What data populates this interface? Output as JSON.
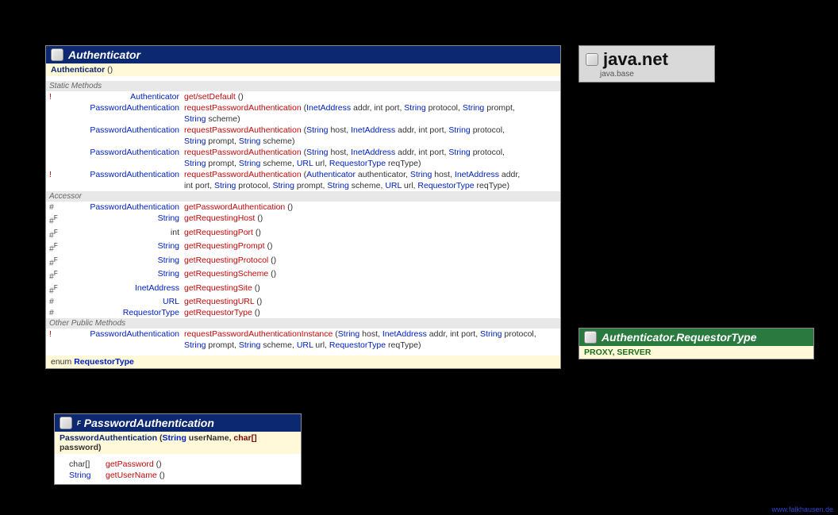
{
  "footer": "www.falkhausen.de",
  "pkg": {
    "name": "java.net",
    "module": "java.base"
  },
  "auth": {
    "title": "Authenticator",
    "constructor": "Authenticator",
    "sect_static": "Static Methods",
    "sect_accessor": "Accessor",
    "sect_other": "Other Public Methods",
    "enum_kw": "enum",
    "enum_name": "RequestorType",
    "static": [
      {
        "mod": "!",
        "ret": "Authenticator",
        "name": "get/setDefault",
        "sig": " ()"
      },
      {
        "mod": "",
        "ret": "PasswordAuthentication",
        "name": "requestPasswordAuthentication",
        "sig": " (",
        "parts": [
          {
            "t": "InetAddress",
            "k": "type"
          },
          {
            "t": " addr, ",
            "k": "dark"
          },
          {
            "t": "int",
            "k": "dark"
          },
          {
            "t": " port, ",
            "k": "dark"
          },
          {
            "t": "String",
            "k": "type"
          },
          {
            "t": " protocol, ",
            "k": "dark"
          },
          {
            "t": "String",
            "k": "type"
          },
          {
            "t": " prompt,",
            "k": "dark"
          }
        ],
        "cont": [
          {
            "t": "String",
            "k": "type"
          },
          {
            "t": " scheme)",
            "k": "dark"
          }
        ]
      },
      {
        "mod": "",
        "ret": "PasswordAuthentication",
        "name": "requestPasswordAuthentication",
        "sig": " (",
        "parts": [
          {
            "t": "String",
            "k": "type"
          },
          {
            "t": " host, ",
            "k": "dark"
          },
          {
            "t": "InetAddress",
            "k": "type"
          },
          {
            "t": " addr, ",
            "k": "dark"
          },
          {
            "t": "int",
            "k": "dark"
          },
          {
            "t": " port, ",
            "k": "dark"
          },
          {
            "t": "String",
            "k": "type"
          },
          {
            "t": " protocol,",
            "k": "dark"
          }
        ],
        "cont": [
          {
            "t": "String",
            "k": "type"
          },
          {
            "t": " prompt, ",
            "k": "dark"
          },
          {
            "t": "String",
            "k": "type"
          },
          {
            "t": " scheme)",
            "k": "dark"
          }
        ]
      },
      {
        "mod": "",
        "ret": "PasswordAuthentication",
        "name": "requestPasswordAuthentication",
        "sig": " (",
        "parts": [
          {
            "t": "String",
            "k": "type"
          },
          {
            "t": " host, ",
            "k": "dark"
          },
          {
            "t": "InetAddress",
            "k": "type"
          },
          {
            "t": " addr, ",
            "k": "dark"
          },
          {
            "t": "int",
            "k": "dark"
          },
          {
            "t": " port, ",
            "k": "dark"
          },
          {
            "t": "String",
            "k": "type"
          },
          {
            "t": " protocol,",
            "k": "dark"
          }
        ],
        "cont": [
          {
            "t": "String",
            "k": "type"
          },
          {
            "t": " prompt, ",
            "k": "dark"
          },
          {
            "t": "String",
            "k": "type"
          },
          {
            "t": " scheme, ",
            "k": "dark"
          },
          {
            "t": "URL",
            "k": "type"
          },
          {
            "t": " url, ",
            "k": "dark"
          },
          {
            "t": "RequestorType",
            "k": "type"
          },
          {
            "t": " reqType)",
            "k": "dark"
          }
        ]
      },
      {
        "mod": "!",
        "ret": "PasswordAuthentication",
        "name": "requestPasswordAuthentication",
        "sig": " (",
        "parts": [
          {
            "t": "Authenticator",
            "k": "type"
          },
          {
            "t": " authenticator, ",
            "k": "dark"
          },
          {
            "t": "String",
            "k": "type"
          },
          {
            "t": " host, ",
            "k": "dark"
          },
          {
            "t": "InetAddress",
            "k": "type"
          },
          {
            "t": " addr,",
            "k": "dark"
          }
        ],
        "cont": [
          {
            "t": "int",
            "k": "dark"
          },
          {
            "t": " port, ",
            "k": "dark"
          },
          {
            "t": "String",
            "k": "type"
          },
          {
            "t": " protocol, ",
            "k": "dark"
          },
          {
            "t": "String",
            "k": "type"
          },
          {
            "t": " prompt, ",
            "k": "dark"
          },
          {
            "t": "String",
            "k": "type"
          },
          {
            "t": " scheme, ",
            "k": "dark"
          },
          {
            "t": "URL",
            "k": "type"
          },
          {
            "t": " url, ",
            "k": "dark"
          },
          {
            "t": "RequestorType",
            "k": "type"
          },
          {
            "t": " reqType)",
            "k": "dark"
          }
        ]
      }
    ],
    "accessor": [
      {
        "mod": "#",
        "ret": "PasswordAuthentication",
        "name": "getPasswordAuthentication",
        "sig": " ()"
      },
      {
        "mod": "#",
        "sup": "F",
        "ret": "String",
        "name": "getRequestingHost",
        "sig": " ()"
      },
      {
        "mod": "#",
        "sup": "F",
        "ret": "int",
        "retdark": true,
        "name": "getRequestingPort",
        "sig": " ()"
      },
      {
        "mod": "#",
        "sup": "F",
        "ret": "String",
        "name": "getRequestingPrompt",
        "sig": " ()"
      },
      {
        "mod": "#",
        "sup": "F",
        "ret": "String",
        "name": "getRequestingProtocol",
        "sig": " ()"
      },
      {
        "mod": "#",
        "sup": "F",
        "ret": "String",
        "name": "getRequestingScheme",
        "sig": " ()"
      },
      {
        "mod": "#",
        "sup": "F",
        "ret": "InetAddress",
        "name": "getRequestingSite",
        "sig": " ()"
      },
      {
        "mod": "#",
        "ret": "URL",
        "name": "getRequestingURL",
        "sig": " ()"
      },
      {
        "mod": "#",
        "ret": "RequestorType",
        "name": "getRequestorType",
        "sig": " ()"
      }
    ],
    "other": [
      {
        "mod": "!",
        "ret": "PasswordAuthentication",
        "name": "requestPasswordAuthenticationInstance",
        "sig": " (",
        "parts": [
          {
            "t": "String",
            "k": "type"
          },
          {
            "t": " host, ",
            "k": "dark"
          },
          {
            "t": "InetAddress",
            "k": "type"
          },
          {
            "t": " addr, ",
            "k": "dark"
          },
          {
            "t": "int",
            "k": "dark"
          },
          {
            "t": " port, ",
            "k": "dark"
          },
          {
            "t": "String",
            "k": "type"
          },
          {
            "t": " protocol,",
            "k": "dark"
          }
        ],
        "cont": [
          {
            "t": "String",
            "k": "type"
          },
          {
            "t": " prompt, ",
            "k": "dark"
          },
          {
            "t": "String",
            "k": "type"
          },
          {
            "t": " scheme, ",
            "k": "dark"
          },
          {
            "t": "URL",
            "k": "type"
          },
          {
            "t": " url, ",
            "k": "dark"
          },
          {
            "t": "RequestorType",
            "k": "type"
          },
          {
            "t": " reqType)",
            "k": "dark"
          }
        ]
      }
    ]
  },
  "pa": {
    "title": "PasswordAuthentication",
    "sup": "F",
    "ctor_name": "PasswordAuthentication",
    "ctor_parts": [
      {
        "t": " (",
        "k": "dark"
      },
      {
        "t": "String",
        "k": "type"
      },
      {
        "t": " userName, ",
        "k": "dark"
      },
      {
        "t": "char[]",
        "k": "darkred"
      },
      {
        "t": " password)",
        "k": "dark"
      }
    ],
    "methods": [
      {
        "ret": "char[]",
        "retdark": true,
        "name": "getPassword",
        "sig": " ()"
      },
      {
        "ret": "String",
        "name": "getUserName",
        "sig": " ()"
      }
    ]
  },
  "rt": {
    "title": "Authenticator.RequestorType",
    "values": "PROXY, SERVER"
  }
}
